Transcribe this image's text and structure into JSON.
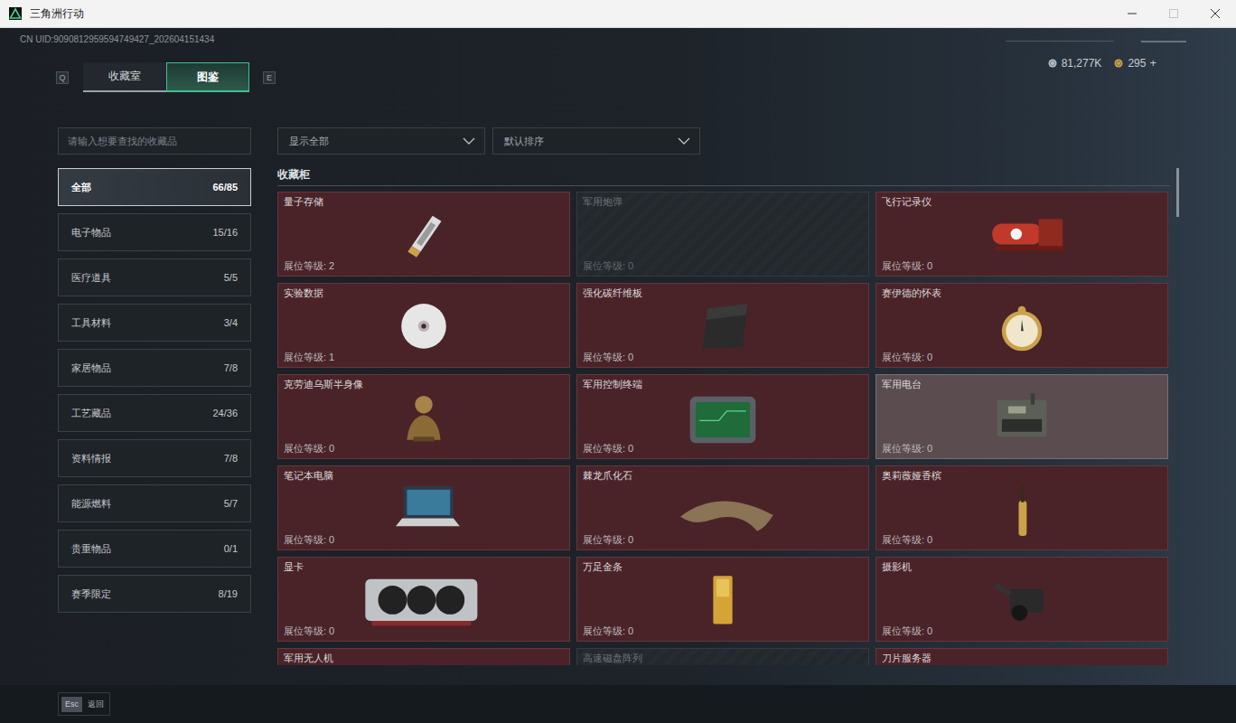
{
  "window": {
    "title": "三角洲行动",
    "maximize_disabled": true
  },
  "uid": "CN UID:9090812959594749427_202604151434",
  "tab_keys": {
    "prev": "Q",
    "next": "E"
  },
  "tabs": [
    {
      "label": "收藏室",
      "selected": false
    },
    {
      "label": "图鉴",
      "selected": true
    }
  ],
  "currency": [
    {
      "amount": "81,277K",
      "color": "#b9bec3"
    },
    {
      "amount": "295",
      "color": "#c9a14e"
    }
  ],
  "currency_add": "+",
  "search": {
    "placeholder": "请输入想要查找的收藏品"
  },
  "filters": [
    {
      "label": "显示全部"
    },
    {
      "label": "默认排序"
    }
  ],
  "categories": [
    {
      "label": "全部",
      "count": "66/85",
      "selected": true
    },
    {
      "label": "电子物品",
      "count": "15/16",
      "selected": false
    },
    {
      "label": "医疗道具",
      "count": "5/5",
      "selected": false
    },
    {
      "label": "工具材料",
      "count": "3/4",
      "selected": false
    },
    {
      "label": "家居物品",
      "count": "7/8",
      "selected": false
    },
    {
      "label": "工艺藏品",
      "count": "24/36",
      "selected": false
    },
    {
      "label": "资料情报",
      "count": "7/8",
      "selected": false
    },
    {
      "label": "能源燃料",
      "count": "5/7",
      "selected": false
    },
    {
      "label": "贵重物品",
      "count": "0/1",
      "selected": false
    },
    {
      "label": "赛季限定",
      "count": "8/19",
      "selected": false
    }
  ],
  "section_title": "收藏柜",
  "items": [
    {
      "name": "量子存储",
      "level_text": "展位等级: 2",
      "unlocked": true,
      "hovered": false
    },
    {
      "name": "军用炮弹",
      "level_text": "展位等级: 0",
      "unlocked": false,
      "hovered": false
    },
    {
      "name": "飞行记录仪",
      "level_text": "展位等级: 0",
      "unlocked": true,
      "hovered": false
    },
    {
      "name": "实验数据",
      "level_text": "展位等级: 1",
      "unlocked": true,
      "hovered": false
    },
    {
      "name": "强化碳纤维板",
      "level_text": "展位等级: 0",
      "unlocked": true,
      "hovered": false
    },
    {
      "name": "赛伊德的怀表",
      "level_text": "展位等级: 0",
      "unlocked": true,
      "hovered": false
    },
    {
      "name": "克劳迪乌斯半身像",
      "level_text": "展位等级: 0",
      "unlocked": true,
      "hovered": false
    },
    {
      "name": "军用控制终端",
      "level_text": "展位等级: 0",
      "unlocked": true,
      "hovered": false
    },
    {
      "name": "军用电台",
      "level_text": "展位等级: 0",
      "unlocked": true,
      "hovered": true
    },
    {
      "name": "笔记本电脑",
      "level_text": "展位等级: 0",
      "unlocked": true,
      "hovered": false
    },
    {
      "name": "棘龙爪化石",
      "level_text": "展位等级: 0",
      "unlocked": true,
      "hovered": false
    },
    {
      "name": "奥莉薇娅香槟",
      "level_text": "展位等级: 0",
      "unlocked": true,
      "hovered": false
    },
    {
      "name": "显卡",
      "level_text": "展位等级: 0",
      "unlocked": true,
      "hovered": false
    },
    {
      "name": "万足金条",
      "level_text": "展位等级: 0",
      "unlocked": true,
      "hovered": false
    },
    {
      "name": "摄影机",
      "level_text": "展位等级: 0",
      "unlocked": true,
      "hovered": false
    },
    {
      "name": "军用无人机",
      "unlocked": true,
      "hovered": false
    },
    {
      "name": "高速磁盘阵列",
      "unlocked": false,
      "hovered": false
    },
    {
      "name": "刀片服务器",
      "unlocked": true,
      "hovered": false
    }
  ],
  "footer": {
    "key": "Esc",
    "label": "返回"
  }
}
